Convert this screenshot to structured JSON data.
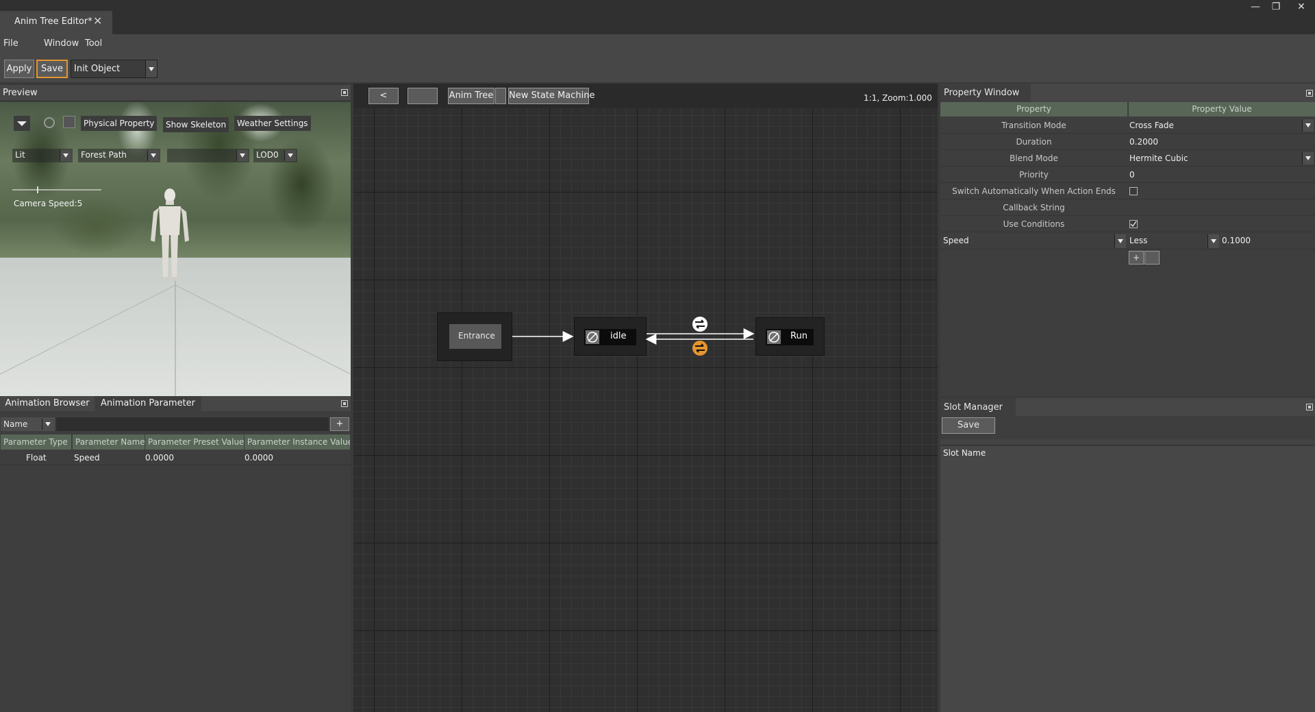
{
  "window": {
    "tab_title": "Anim Tree Editor*",
    "close_glyph": "✕",
    "controls": {
      "minimize": "—",
      "restore": "❐",
      "close": "✕"
    }
  },
  "menu": {
    "file": "File",
    "window": "Window",
    "tool": "Tool"
  },
  "toolbar": {
    "apply_label": "Apply",
    "save_label": "Save",
    "init_select_value": "Init Object"
  },
  "preview": {
    "title": "Preview",
    "buttons": {
      "physical": "Physical Property",
      "skeleton": "Show Skeleton",
      "weather": "Weather Settings"
    },
    "selects": {
      "lighting": "Lit",
      "scene": "Forest Path",
      "blank": "",
      "lod": "LOD0"
    },
    "camera_speed": "Camera Speed:5"
  },
  "params": {
    "tabs": {
      "browser": "Animation Browser",
      "parameter": "Animation Parameter"
    },
    "filter_select": "Name",
    "add_label": "+",
    "columns": [
      "Parameter Type",
      "Parameter Name",
      "Parameter Preset Value",
      "Parameter Instance Value"
    ],
    "rows": [
      {
        "type": "Float",
        "name": "Speed",
        "preset": "0.0000",
        "instance": "0.0000"
      }
    ]
  },
  "graph": {
    "back_label": "<",
    "forward_label": ">",
    "crumb_root": "Anim Tree",
    "crumb_current": "New State Machine",
    "zoom": "1:1, Zoom:1.000",
    "nodes": {
      "entrance": "Entrance",
      "idle": "idle",
      "run": "Run"
    }
  },
  "property": {
    "title": "Property Window",
    "col_property": "Property",
    "col_value": "Property Value",
    "rows": {
      "transition_mode": {
        "name": "Transition Mode",
        "value": "Cross Fade"
      },
      "duration": {
        "name": "Duration",
        "value": "0.2000"
      },
      "blend_mode": {
        "name": "Blend Mode",
        "value": "Hermite Cubic"
      },
      "priority": {
        "name": "Priority",
        "value": "0"
      },
      "switch_auto": {
        "name": "Switch Automatically When Action Ends",
        "checked": false
      },
      "callback": {
        "name": "Callback String",
        "value": ""
      },
      "use_conditions": {
        "name": "Use Conditions",
        "checked": true
      }
    },
    "condition": {
      "param": "Speed",
      "op": "Less",
      "value": "0.1000"
    },
    "add_label": "+"
  },
  "slot": {
    "title": "Slot Manager",
    "save_label": "Save",
    "column": "Slot Name"
  },
  "colors": {
    "accent": "#e6962e",
    "panel": "#3e3e3e",
    "header": "#586658"
  }
}
